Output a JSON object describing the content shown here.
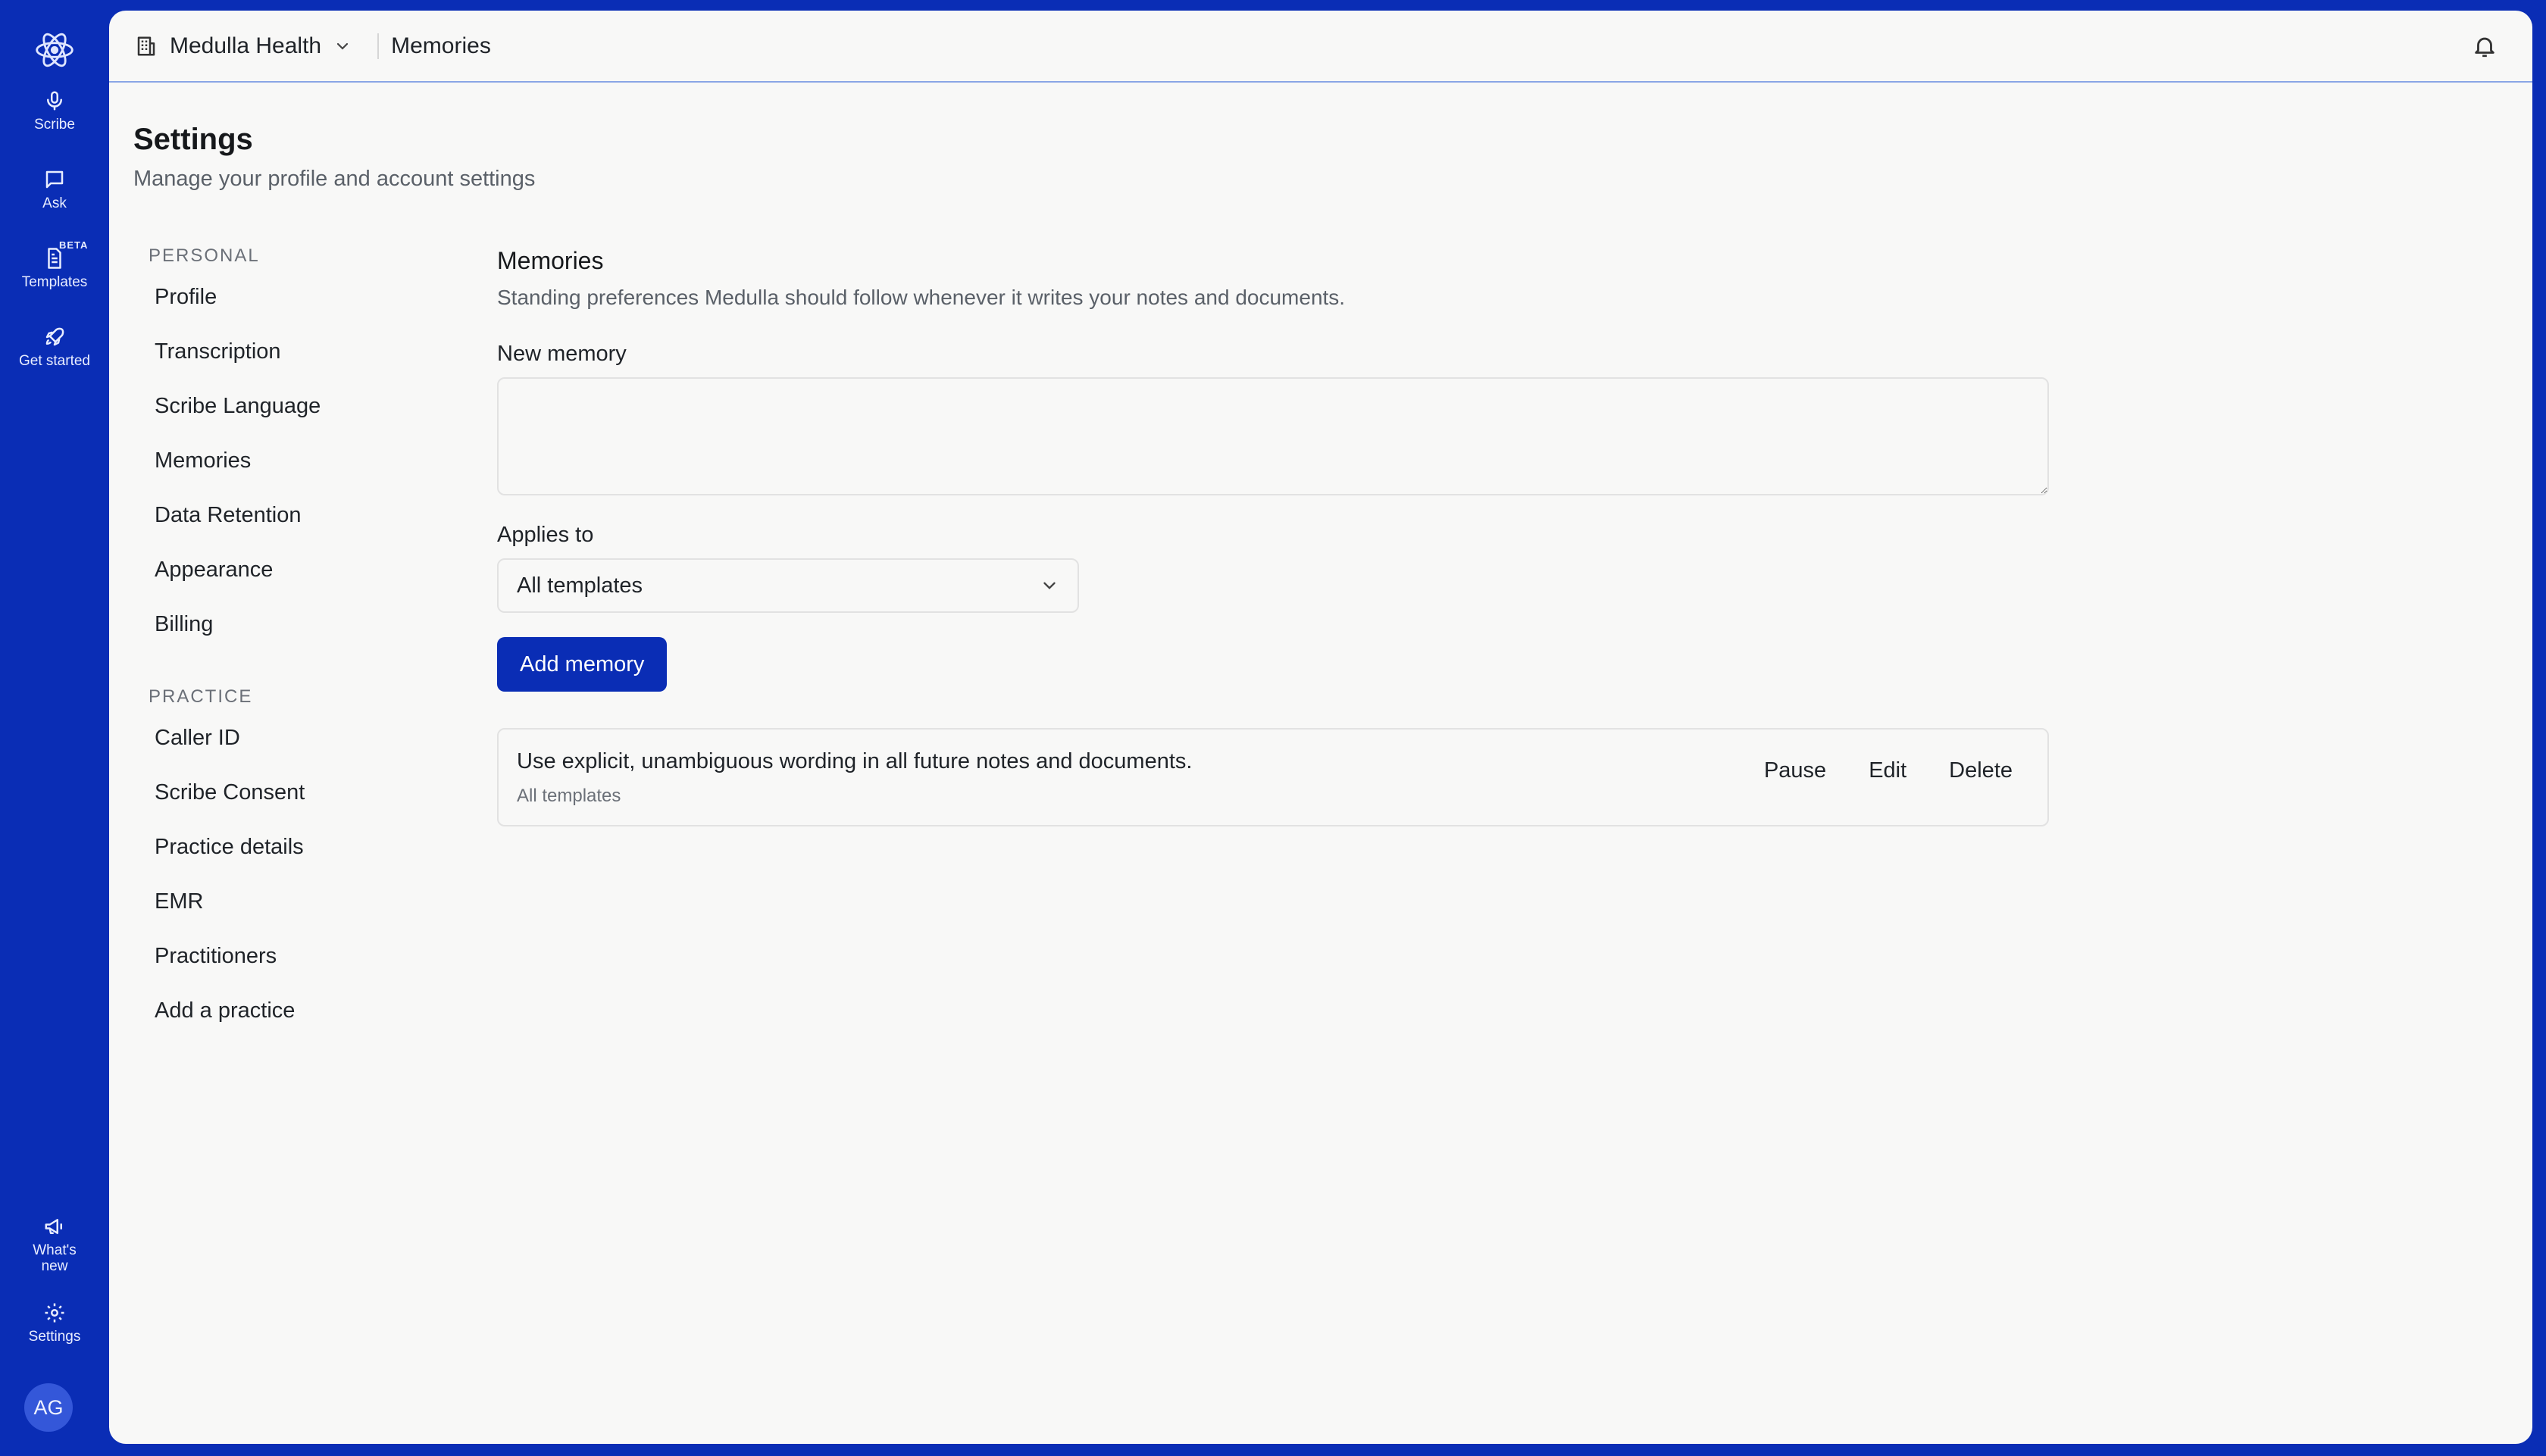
{
  "rail": {
    "logo_icon": "atom-logo-icon",
    "items": [
      {
        "label": "Scribe",
        "icon": "microphone-icon"
      },
      {
        "label": "Ask",
        "icon": "chat-bubble-icon"
      },
      {
        "label": "Templates",
        "icon": "document-icon",
        "badge": "BETA"
      },
      {
        "label": "Get started",
        "icon": "rocket-icon"
      }
    ],
    "bottom_items": [
      {
        "label": "What's new",
        "icon": "megaphone-icon"
      },
      {
        "label": "Settings",
        "icon": "gear-icon"
      }
    ],
    "avatar_initials": "AG"
  },
  "topbar": {
    "org_name": "Medulla Health",
    "breadcrumb": "Memories"
  },
  "page": {
    "title": "Settings",
    "subtitle": "Manage your profile and account settings"
  },
  "nav": {
    "personal_label": "PERSONAL",
    "personal_items": [
      "Profile",
      "Transcription",
      "Scribe Language",
      "Memories",
      "Data Retention",
      "Appearance",
      "Billing"
    ],
    "practice_label": "PRACTICE",
    "practice_items": [
      "Caller ID",
      "Scribe Consent",
      "Practice details",
      "EMR",
      "Practitioners",
      "Add a practice"
    ]
  },
  "memories": {
    "title": "Memories",
    "description": "Standing preferences Medulla should follow whenever it writes your notes and documents.",
    "new_memory_label": "New memory",
    "new_memory_value": "",
    "applies_to_label": "Applies to",
    "applies_to_value": "All templates",
    "add_button": "Add memory",
    "list": [
      {
        "text": "Use explicit, unambiguous wording in all future notes and documents.",
        "scope": "All templates",
        "actions": {
          "pause": "Pause",
          "edit": "Edit",
          "delete": "Delete"
        }
      }
    ]
  },
  "colors": {
    "brand": "#0a2db5",
    "panel_bg": "#f8f8f7",
    "border": "#e2e2e2"
  }
}
